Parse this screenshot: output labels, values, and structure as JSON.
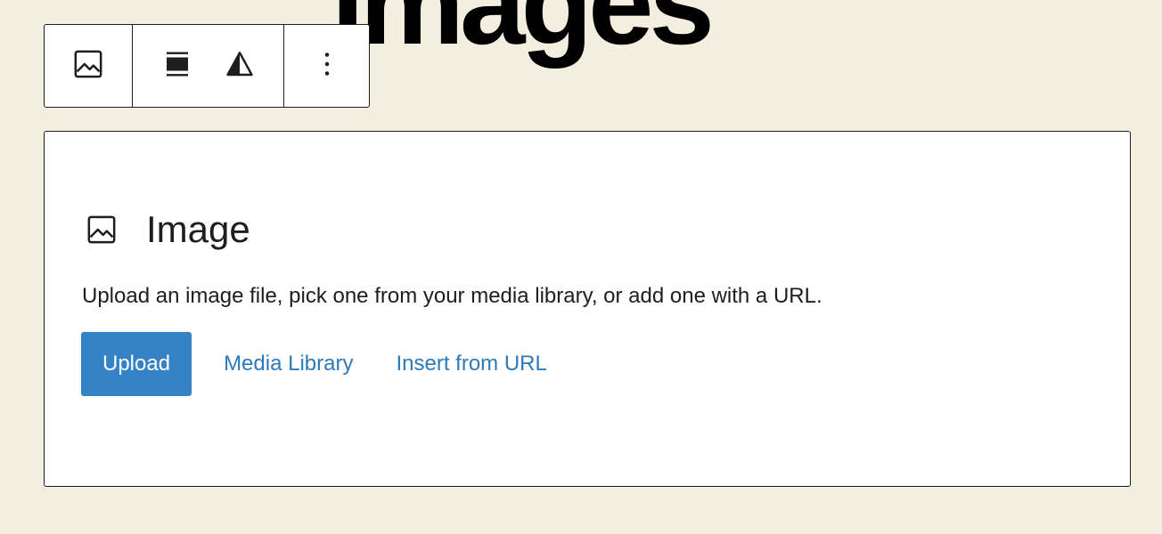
{
  "heading": {
    "text": "Images"
  },
  "toolbar": {
    "block_icon": "image-icon",
    "align_icon": "align-center-icon",
    "flip_icon": "contrast-triangle-icon",
    "more_icon": "more-vertical-icon"
  },
  "placeholder": {
    "icon": "image-icon",
    "title": "Image",
    "instructions": "Upload an image file, pick one from your media library, or add one with a URL.",
    "buttons": {
      "upload": "Upload",
      "media_library": "Media Library",
      "insert_url": "Insert from URL"
    }
  },
  "colors": {
    "background": "#f4eee0",
    "primary": "#3582c4",
    "link": "#2e7ab8",
    "border": "#1e1e1e"
  }
}
